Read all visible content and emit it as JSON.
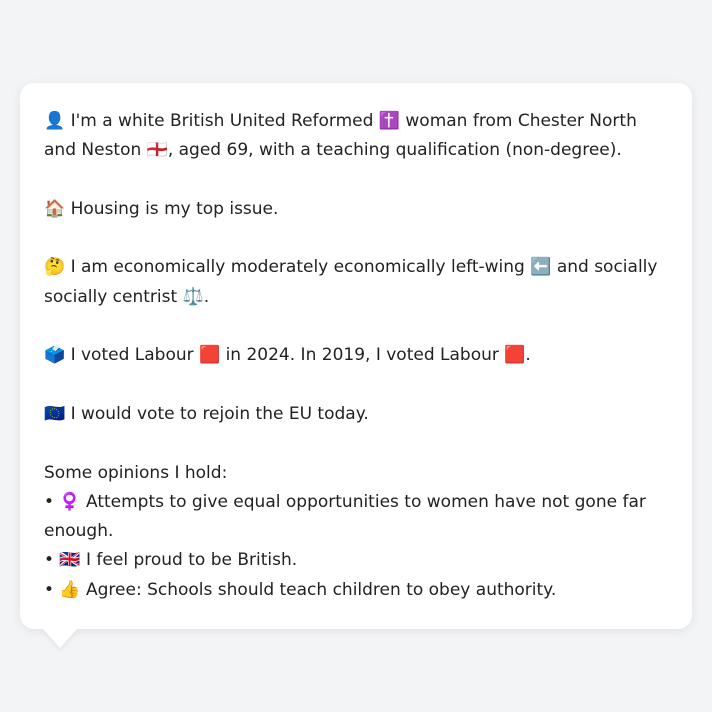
{
  "message": {
    "identity": "👤 I'm a white British United Reformed ✝️ woman from Chester North and Neston 🏴󠁧󠁢󠁥󠁮󠁧󠁿, aged 69, with a teaching qualification (non-degree).",
    "top_issue": "🏠 Housing is my top issue.",
    "ideology": "🤔 I am economically moderately economically left-wing ⬅️ and socially socially centrist ⚖️.",
    "vote_history": "🗳️ I voted Labour 🟥 in 2024. In 2019, I voted Labour 🟥.",
    "eu_stance": "🇪🇺 I would vote to rejoin the EU today.",
    "opinions_heading": "Some opinions I hold:",
    "opinions": [
      "• ♀️ Attempts to give equal opportunities to women have not gone far enough.",
      "• 🇬🇧 I feel proud to be British.",
      "• 👍 Agree: Schools should teach children to obey authority."
    ]
  },
  "colors": {
    "page_background": "#f3f4f6",
    "bubble_background": "#ffffff",
    "text": "#222222"
  }
}
